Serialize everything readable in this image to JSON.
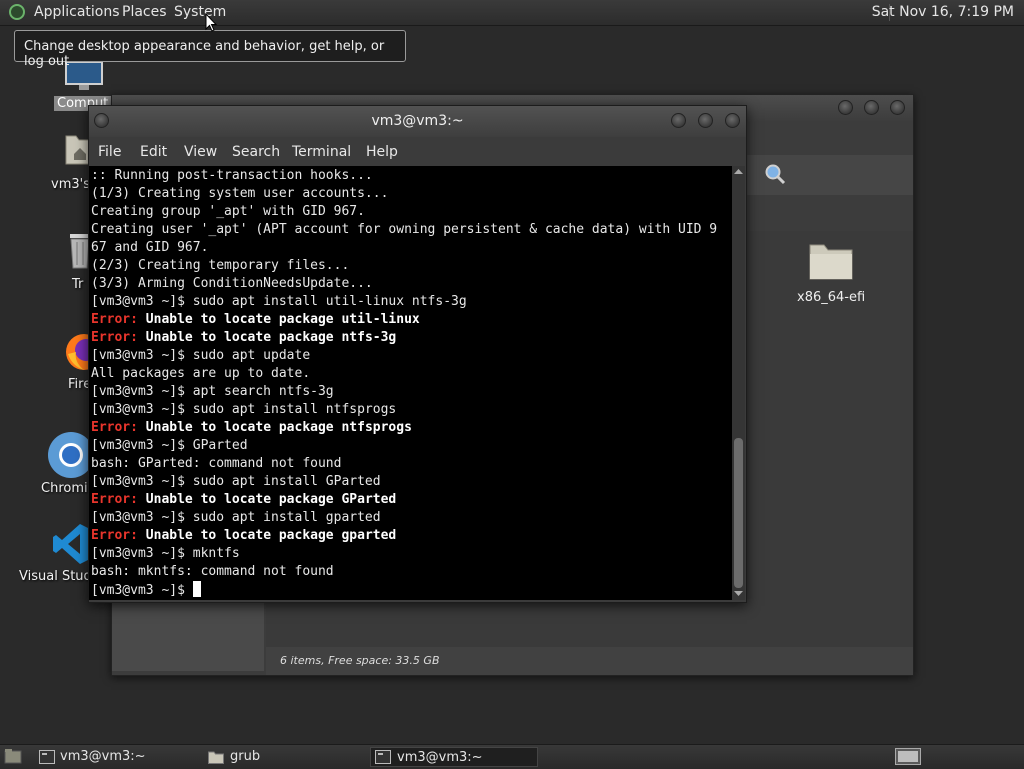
{
  "top_panel": {
    "applications": "Applications",
    "places": "Places",
    "system": "System",
    "clock": "Sat Nov 16,  7:19 PM"
  },
  "tooltip": "Change desktop appearance and behavior, get help, or log out",
  "desktop_icons": {
    "computer": "Comput",
    "home": "vm3's",
    "trash": "Tr",
    "firefox": "Fire",
    "chromium": "Chromi",
    "vscode": "Visual Studi"
  },
  "file_manager": {
    "folder_label": "x86_64-efi",
    "status": "6 items, Free space: 33.5 GB"
  },
  "terminal": {
    "title": "vm3@vm3:~",
    "menu": [
      "File",
      "Edit",
      "View",
      "Search",
      "Terminal",
      "Help"
    ],
    "lines": [
      {
        "text": ":: Running post-transaction hooks..."
      },
      {
        "text": "(1/3) Creating system user accounts..."
      },
      {
        "text": "Creating group '_apt' with GID 967."
      },
      {
        "text": "Creating user '_apt' (APT account for owning persistent & cache data) with UID 9"
      },
      {
        "text": "67 and GID 967."
      },
      {
        "text": "(2/3) Creating temporary files..."
      },
      {
        "text": "(3/3) Arming ConditionNeedsUpdate..."
      },
      {
        "text": "[vm3@vm3 ~]$ sudo apt install util-linux ntfs-3g"
      },
      {
        "error": "Error:",
        "text": " Unable to locate package util-linux"
      },
      {
        "error": "Error:",
        "text": " Unable to locate package ntfs-3g"
      },
      {
        "text": "[vm3@vm3 ~]$ sudo apt update"
      },
      {
        "text": "All packages are up to date."
      },
      {
        "text": "[vm3@vm3 ~]$ apt search ntfs-3g"
      },
      {
        "text": "[vm3@vm3 ~]$ sudo apt install ntfsprogs"
      },
      {
        "error": "Error:",
        "text": " Unable to locate package ntfsprogs"
      },
      {
        "text": "[vm3@vm3 ~]$ GParted"
      },
      {
        "text": "bash: GParted: command not found"
      },
      {
        "text": "[vm3@vm3 ~]$ sudo apt install GParted"
      },
      {
        "error": "Error:",
        "text": " Unable to locate package GParted"
      },
      {
        "text": "[vm3@vm3 ~]$ sudo apt install gparted"
      },
      {
        "error": "Error:",
        "text": " Unable to locate package gparted"
      },
      {
        "text": "[vm3@vm3 ~]$ mkntfs"
      },
      {
        "text": "bash: mkntfs: command not found"
      },
      {
        "text": "[vm3@vm3 ~]$ ",
        "cursor": true
      }
    ]
  },
  "taskbar": {
    "items": [
      "vm3@vm3:~",
      "grub",
      "vm3@vm3:~"
    ]
  },
  "colors": {
    "error_red": "#e8352c",
    "terminal_bg": "#000000",
    "panel_bg": "#2e2e2e"
  }
}
